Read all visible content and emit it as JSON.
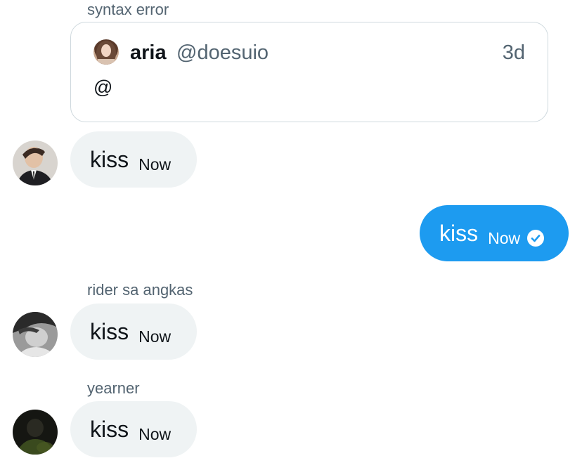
{
  "quoted": {
    "sender_name": "syntax error",
    "author_name": "aria",
    "author_handle": "@doesuio",
    "time": "3d",
    "text": "@"
  },
  "messages": [
    {
      "direction": "incoming",
      "text": "kiss",
      "time": "Now"
    },
    {
      "direction": "outgoing",
      "text": "kiss",
      "time": "Now",
      "status_icon": "check-circle-icon"
    },
    {
      "direction": "incoming",
      "sender_name": "rider sa angkas",
      "text": "kiss",
      "time": "Now"
    },
    {
      "direction": "incoming",
      "sender_name": "yearner",
      "text": "kiss",
      "time": "Now"
    }
  ],
  "colors": {
    "outgoing_bubble": "#1d9bf0",
    "incoming_bubble": "#eff3f4",
    "secondary_text": "#536471"
  }
}
